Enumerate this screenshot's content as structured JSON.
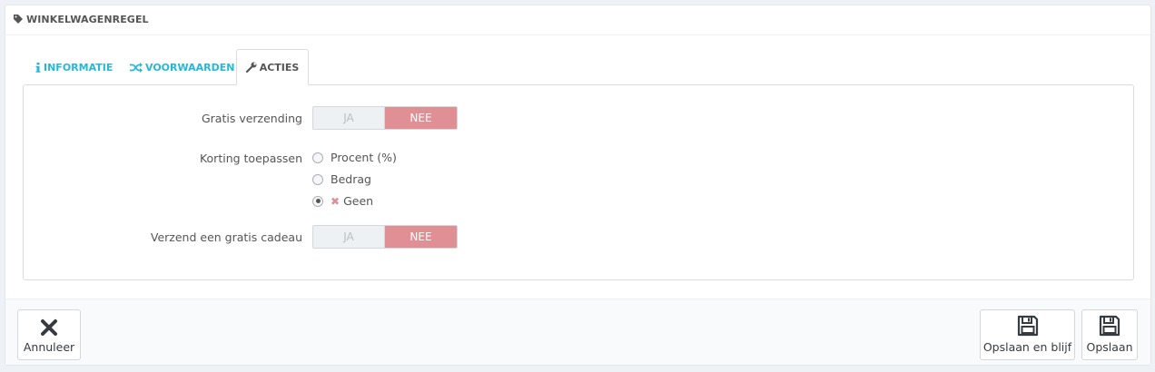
{
  "panel": {
    "title": "WINKELWAGENREGEL",
    "title_icon": "tag-icon"
  },
  "tabs": [
    {
      "label": "INFORMATIE",
      "icon": "info-icon",
      "active": false
    },
    {
      "label": "VOORWAARDEN",
      "icon": "shuffle-icon",
      "active": false
    },
    {
      "label": "ACTIES",
      "icon": "wrench-icon",
      "active": true
    }
  ],
  "form": {
    "free_shipping": {
      "label": "Gratis verzending",
      "yes": "JA",
      "no": "NEE",
      "value": "NEE"
    },
    "discount": {
      "label": "Korting toepassen",
      "options": [
        {
          "label": "Procent (%)",
          "checked": false
        },
        {
          "label": "Bedrag",
          "checked": false
        },
        {
          "label": "Geen",
          "checked": true,
          "icon": "x-icon"
        }
      ]
    },
    "free_gift": {
      "label": "Verzend een gratis cadeau",
      "yes": "JA",
      "no": "NEE",
      "value": "NEE"
    }
  },
  "footer": {
    "cancel_label": "Annuleer",
    "save_stay_label": "Opslaan en blijf",
    "save_label": "Opslaan"
  },
  "colors": {
    "accent": "#25b9d7",
    "switch_off": "#e08f95"
  }
}
